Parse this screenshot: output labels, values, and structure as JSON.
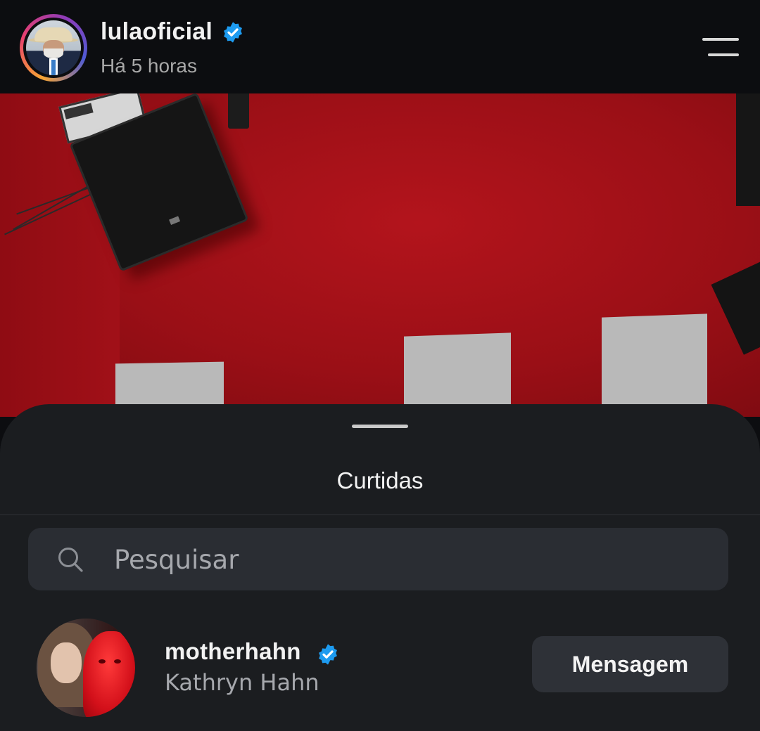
{
  "post": {
    "username": "lulaoficial",
    "time": "Há 5 horas",
    "verified": true
  },
  "icons": {
    "verified": "verified-badge-icon",
    "menu": "menu-icon",
    "search": "search-icon"
  },
  "colors": {
    "verified_blue": "#1d9bf0",
    "sheet_background": "#1b1d20",
    "photo_red": "#a11018"
  },
  "likes_sheet": {
    "title": "Curtidas",
    "search": {
      "placeholder": "Pesquisar",
      "value": ""
    },
    "users": [
      {
        "handle": "motherhahn",
        "name": "Kathryn Hahn",
        "verified": true,
        "action_label": "Mensagem"
      }
    ]
  }
}
